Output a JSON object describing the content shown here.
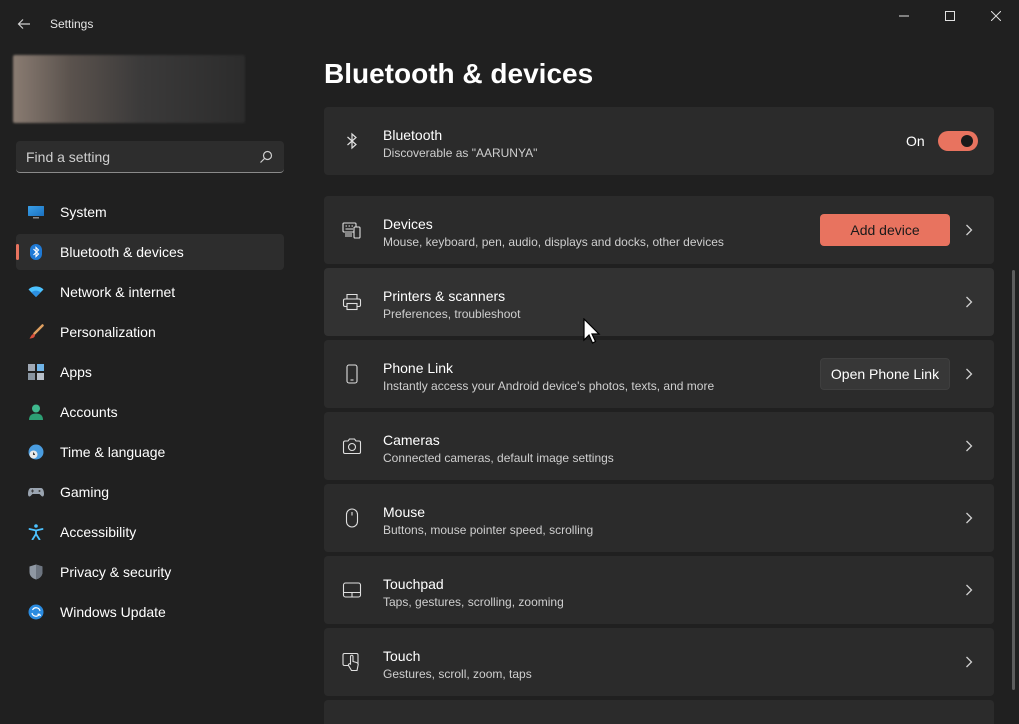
{
  "app": {
    "title": "Settings"
  },
  "search": {
    "placeholder": "Find a setting"
  },
  "sidebar": {
    "items": [
      {
        "label": "System",
        "icon": "monitor-icon"
      },
      {
        "label": "Bluetooth & devices",
        "icon": "bluetooth-icon",
        "selected": true
      },
      {
        "label": "Network & internet",
        "icon": "wifi-icon"
      },
      {
        "label": "Personalization",
        "icon": "brush-icon"
      },
      {
        "label": "Apps",
        "icon": "apps-icon"
      },
      {
        "label": "Accounts",
        "icon": "person-icon"
      },
      {
        "label": "Time & language",
        "icon": "globe-clock-icon"
      },
      {
        "label": "Gaming",
        "icon": "gamepad-icon"
      },
      {
        "label": "Accessibility",
        "icon": "accessibility-icon"
      },
      {
        "label": "Privacy & security",
        "icon": "shield-icon"
      },
      {
        "label": "Windows Update",
        "icon": "update-icon"
      }
    ]
  },
  "main": {
    "title": "Bluetooth & devices",
    "bluetooth": {
      "title": "Bluetooth",
      "subtitle": "Discoverable as \"AARUNYA\"",
      "toggle_label": "On",
      "toggle_on": true
    },
    "cards": [
      {
        "title": "Devices",
        "subtitle": "Mouse, keyboard, pen, audio, displays and docks, other devices",
        "button": "Add device",
        "icon": "devices-icon"
      },
      {
        "title": "Printers & scanners",
        "subtitle": "Preferences, troubleshoot",
        "icon": "printer-icon"
      },
      {
        "title": "Phone Link",
        "subtitle": "Instantly access your Android device's photos, texts, and more",
        "button": "Open Phone Link",
        "icon": "phone-icon"
      },
      {
        "title": "Cameras",
        "subtitle": "Connected cameras, default image settings",
        "icon": "camera-icon"
      },
      {
        "title": "Mouse",
        "subtitle": "Buttons, mouse pointer speed, scrolling",
        "icon": "mouse-icon"
      },
      {
        "title": "Touchpad",
        "subtitle": "Taps, gestures, scrolling, zooming",
        "icon": "touchpad-icon"
      },
      {
        "title": "Touch",
        "subtitle": "Gestures, scroll, zoom, taps",
        "icon": "touch-icon"
      }
    ]
  },
  "colors": {
    "background": "#202020",
    "card": "#2b2b2b",
    "accent": "#e8735f",
    "text_secondary": "#cfcfcf"
  }
}
